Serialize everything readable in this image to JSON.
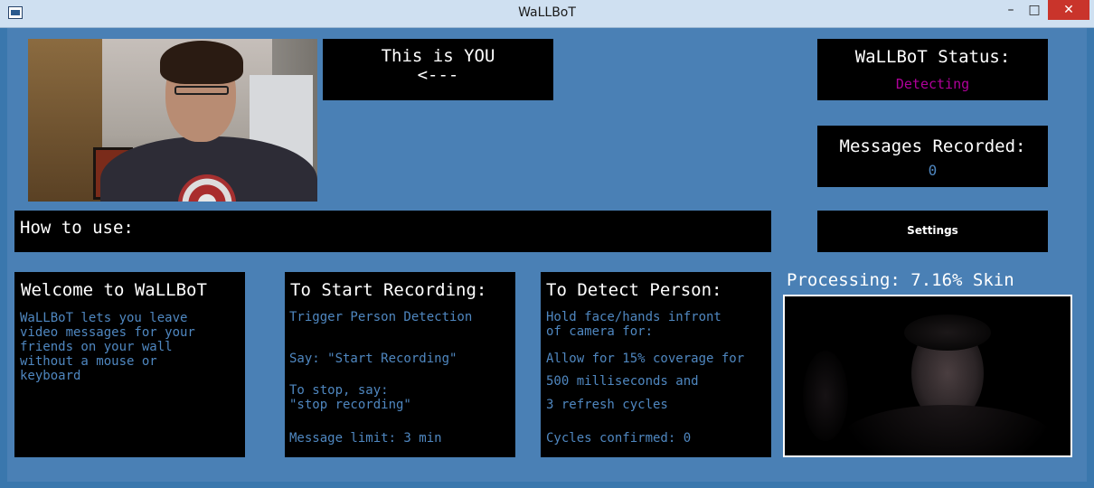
{
  "window": {
    "title": "WaLLBoT",
    "minimize_glyph": "–",
    "maximize_glyph": "□",
    "close_glyph": "✕"
  },
  "you_panel": {
    "line1": "This is YOU",
    "line2": "<---"
  },
  "status_panel": {
    "label": "WaLLBoT Status:",
    "value": "Detecting",
    "value_color": "#b0009a"
  },
  "messages_panel": {
    "label": "Messages Recorded:",
    "value": "0"
  },
  "settings_button": {
    "label": "Settings"
  },
  "how_to_use": {
    "label": "How to use:"
  },
  "welcome_panel": {
    "title": "Welcome to WaLLBoT",
    "body": "WaLLBoT lets you leave\nvideo messages for your\nfriends on your wall\nwithout a mouse or\nkeyboard"
  },
  "start_panel": {
    "title": "To Start Recording:",
    "line1": "Trigger Person Detection",
    "line2": "Say: \"Start Recording\"",
    "line3": "To stop, say:\n\"stop recording\"",
    "line4": "Message limit: 3 min"
  },
  "detect_panel": {
    "title": "To Detect Person:",
    "line1": "Hold face/hands infront\nof camera for:",
    "line2": "Allow for 15% coverage for",
    "line3": "500 milliseconds and",
    "line4": "3 refresh cycles",
    "line5": "Cycles confirmed: 0"
  },
  "processing": {
    "label": "Processing: 7.16% Skin"
  },
  "colors": {
    "client_bg": "#4a80b5",
    "panel_bg": "#000000",
    "info_text": "#4f87c0"
  }
}
